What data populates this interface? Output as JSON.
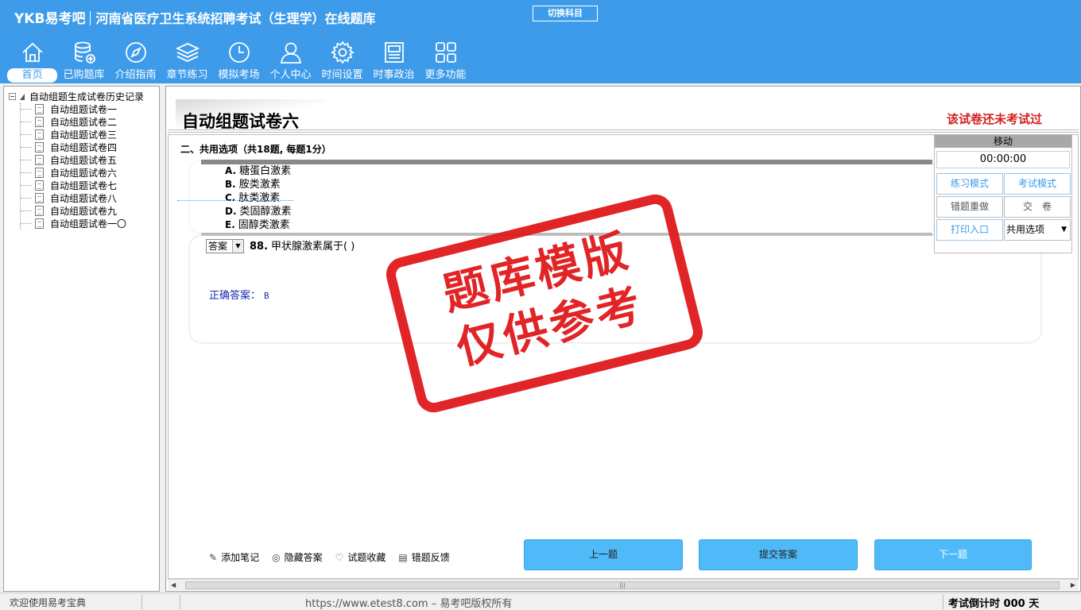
{
  "header": {
    "logo": "YKB易考吧",
    "title": "河南省医疗卫生系统招聘考试（生理学）在线题库",
    "switch_subject": "切换科目"
  },
  "nav": {
    "items": [
      {
        "label": "首页",
        "icon": "home-icon"
      },
      {
        "label": "已购题库",
        "icon": "database-icon"
      },
      {
        "label": "介绍指南",
        "icon": "compass-icon"
      },
      {
        "label": "章节练习",
        "icon": "layers-icon"
      },
      {
        "label": "模拟考场",
        "icon": "clock-icon"
      },
      {
        "label": "个人中心",
        "icon": "user-icon"
      },
      {
        "label": "时间设置",
        "icon": "gear-icon"
      },
      {
        "label": "时事政治",
        "icon": "newspaper-icon"
      },
      {
        "label": "更多功能",
        "icon": "grid-icon"
      }
    ]
  },
  "sidebar": {
    "root_label": "自动组题生成试卷历史记录",
    "items": [
      "自动组题试卷一",
      "自动组题试卷二",
      "自动组题试卷三",
      "自动组题试卷四",
      "自动组题试卷五",
      "自动组题试卷六",
      "自动组题试卷七",
      "自动组题试卷八",
      "自动组题试卷九",
      "自动组题试卷一〇"
    ]
  },
  "paper": {
    "title": "自动组题试卷六",
    "status": "该试卷还未考试过",
    "section_title": "二、共用选项（共18题, 每题1分）"
  },
  "question": {
    "options": [
      {
        "letter": "A.",
        "text": "糖蛋白激素"
      },
      {
        "letter": "B.",
        "text": "胺类激素"
      },
      {
        "letter": "C.",
        "text": "肽类激素"
      },
      {
        "letter": "D.",
        "text": "类固醇激素"
      },
      {
        "letter": "E.",
        "text": "固醇类激素"
      }
    ],
    "answer_select": "答案",
    "number": "88.",
    "text": "甲状腺激素属于( )",
    "correct_label": "正确答案：",
    "correct_value": "B"
  },
  "stamp": {
    "line1": "题库模版",
    "line2": "仅供参考"
  },
  "control_panel": {
    "header": "移动",
    "timer": "00:00:00",
    "practice_mode": "练习模式",
    "exam_mode": "考试模式",
    "redo_wrong": "错题重做",
    "submit_paper": "交　卷",
    "print_entry": "打印入口",
    "question_type": "共用选项"
  },
  "tools": {
    "add_note": "添加笔记",
    "hide_answer": "隐藏答案",
    "favorite": "试题收藏",
    "report_error": "错题反馈"
  },
  "buttons": {
    "prev": "上一题",
    "submit": "提交答案",
    "next": "下一题"
  },
  "statusbar": {
    "welcome": "欢迎使用易考宝典",
    "copyright": "https://www.etest8.com – 易考吧版权所有",
    "countdown": "考试倒计时 000 天"
  },
  "colors": {
    "header_bg": "#3d9be9",
    "stamp_red": "#e0191b",
    "status_red": "#d32020",
    "button_blue": "#4fbaf7"
  }
}
